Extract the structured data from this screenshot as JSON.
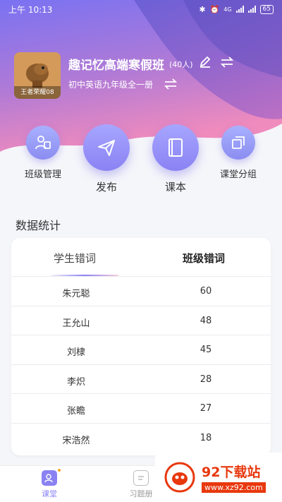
{
  "status_bar": {
    "time": "上午 10:13",
    "battery": "65",
    "network": "4G"
  },
  "header": {
    "avatar_caption": "王者荣耀08",
    "class_name": "趣记忆高端寒假班",
    "student_count": "(40人)",
    "textbook": "初中英语九年级全一册"
  },
  "actions": [
    {
      "label": "班级管理",
      "icon": "users-icon"
    },
    {
      "label": "发布",
      "icon": "send-icon"
    },
    {
      "label": "课本",
      "icon": "book-icon"
    },
    {
      "label": "课堂分组",
      "icon": "groups-icon"
    }
  ],
  "stats": {
    "title": "数据统计",
    "tabs": [
      "学生错词",
      "班级错词"
    ],
    "active_tab": "学生错词",
    "rows": [
      {
        "name": "朱元聪",
        "value": "60"
      },
      {
        "name": "王允山",
        "value": "48"
      },
      {
        "name": "刘棣",
        "value": "45"
      },
      {
        "name": "李炽",
        "value": "28"
      },
      {
        "name": "张瞻",
        "value": "27"
      },
      {
        "name": "宋浩然",
        "value": "18"
      }
    ]
  },
  "bottom_nav": [
    {
      "label": "课堂",
      "active": true
    },
    {
      "label": "习题册",
      "active": false
    }
  ],
  "watermark": {
    "title": "92下载站",
    "url": "www.xz92.com"
  },
  "colors": {
    "accent": "#8a82f3",
    "hero_top": "#7b6ff0",
    "hero_bottom": "#e77fb9"
  }
}
